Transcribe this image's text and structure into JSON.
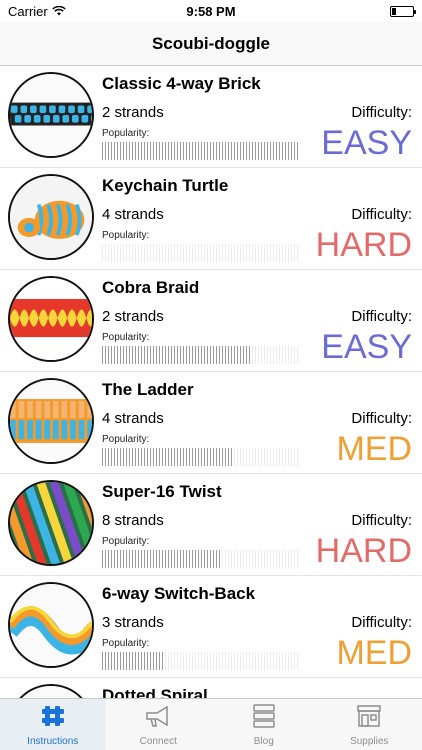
{
  "status": {
    "carrier": "Carrier",
    "time": "9:58 PM"
  },
  "nav": {
    "title": "Scoubi-doggle"
  },
  "labels": {
    "popularity": "Popularity:",
    "difficulty": "Difficulty:"
  },
  "colors": {
    "easy": "#6b6bd6",
    "hard": "#e46a6a",
    "med": "#f0a033",
    "tab_active": "#1a73d9"
  },
  "patterns": [
    {
      "name": "Classic 4-way Brick",
      "strands": "2 strands",
      "difficulty": "EASY",
      "level": "easy",
      "popularity": 1.0,
      "image": "brick-braid-photo"
    },
    {
      "name": "Keychain Turtle",
      "strands": "4 strands",
      "difficulty": "HARD",
      "level": "hard",
      "popularity": 0.0,
      "image": "turtle-keychain-photo"
    },
    {
      "name": "Cobra Braid",
      "strands": "2 strands",
      "difficulty": "EASY",
      "level": "easy",
      "popularity": 0.76,
      "image": "cobra-braid-photo"
    },
    {
      "name": "The Ladder",
      "strands": "4 strands",
      "difficulty": "MED",
      "level": "med",
      "popularity": 0.66,
      "image": "ladder-braid-photo"
    },
    {
      "name": "Super-16 Twist",
      "strands": "8 strands",
      "difficulty": "HARD",
      "level": "hard",
      "popularity": 0.6,
      "image": "super16-twist-photo"
    },
    {
      "name": "6-way Switch-Back",
      "strands": "3 strands",
      "difficulty": "MED",
      "level": "med",
      "popularity": 0.32,
      "image": "switchback-braid-photo"
    },
    {
      "name": "Dotted Spiral",
      "strands": "",
      "difficulty": "",
      "level": "",
      "popularity": 0,
      "image": "dotted-spiral-photo"
    }
  ],
  "tabs": [
    {
      "label": "Instructions",
      "icon": "knot-icon",
      "active": true
    },
    {
      "label": "Connect",
      "icon": "megaphone-icon",
      "active": false
    },
    {
      "label": "Blog",
      "icon": "stacked-boxes-icon",
      "active": false
    },
    {
      "label": "Supplies",
      "icon": "storefront-icon",
      "active": false
    }
  ]
}
